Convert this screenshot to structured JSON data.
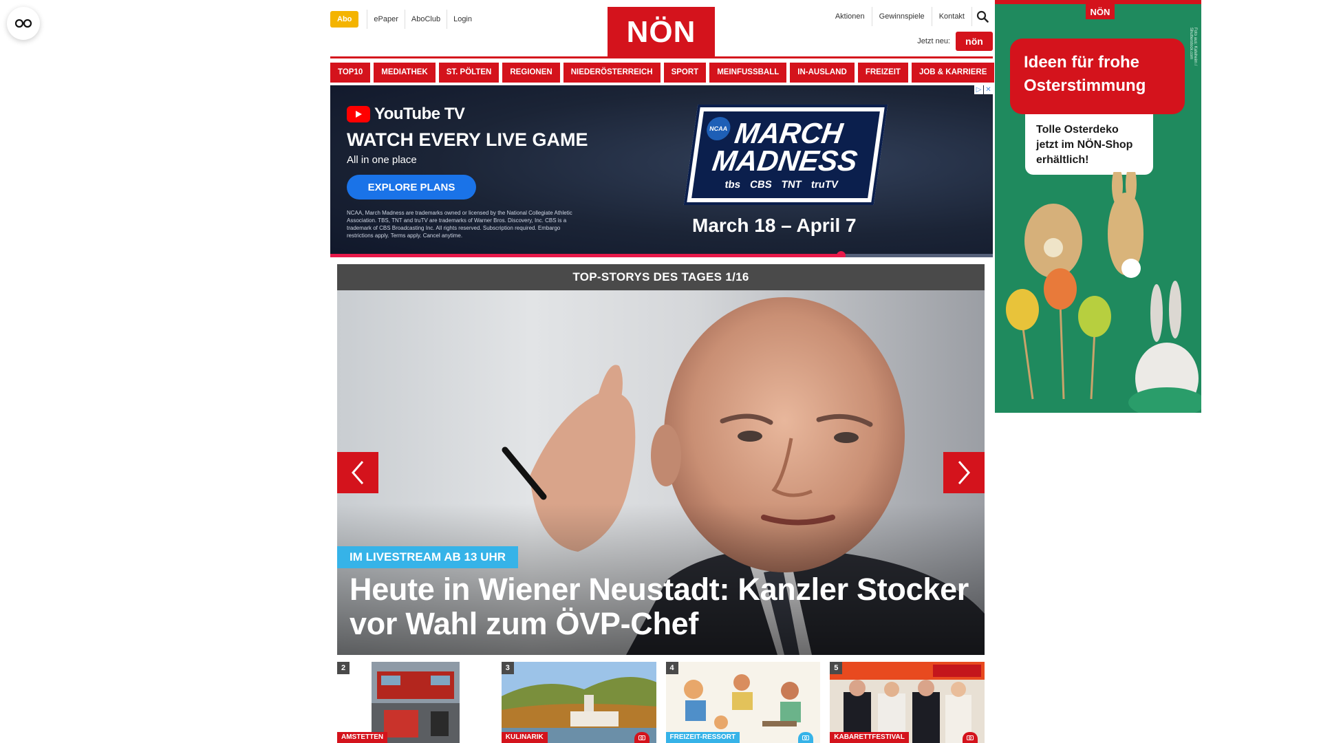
{
  "accessibility": {
    "icon": "eye-glasses-icon"
  },
  "header": {
    "abo": "Abo",
    "links": [
      "ePaper",
      "AboClub",
      "Login"
    ],
    "logo": "NÖN",
    "right_links": [
      "Aktionen",
      "Gewinnspiele",
      "Kontakt"
    ],
    "search_icon": "search-icon",
    "jetzt_neu": "Jetzt neu:",
    "mini_logo": "nön"
  },
  "nav": [
    "TOP10",
    "MEDIATHEK",
    "ST. PÖLTEN",
    "REGIONEN",
    "NIEDERÖSTERREICH",
    "SPORT",
    "MEINFUSSBALL",
    "IN-AUSLAND",
    "FREIZEIT",
    "JOB & KARRIERE"
  ],
  "ad": {
    "brand": "YouTube TV",
    "headline": "WATCH EVERY LIVE GAME",
    "sub": "All in one place",
    "cta": "EXPLORE PLANS",
    "fine_print": "NCAA, March Madness are trademarks owned or licensed by the National Collegiate Athletic Association. TBS, TNT and truTV are trademarks of Warner Bros. Discovery, Inc. CBS is a trademark of CBS Broadcasting Inc. All rights reserved. Subscription required. Embargo restrictions apply. Terms apply. Cancel anytime.",
    "logo_badge": "NCAA",
    "event_title": "MARCH MADNESS",
    "networks": [
      "tbs",
      "CBS",
      "TNT",
      "truTV"
    ],
    "dates": "March 18 – April 7",
    "progress": 0.77,
    "close_glyphs": [
      "▷",
      "✕"
    ]
  },
  "top_stories": {
    "label": "TOP-STORYS DES TAGES 1/16",
    "badge": "IM LIVESTREAM AB 13 UHR",
    "title": "Heute in Wiener Neustadt: Kanzler Stocker vor Wahl zum ÖVP-Chef"
  },
  "teasers": [
    {
      "num": "2",
      "category": "AMSTETTEN",
      "cat_color": "#d4131c",
      "camera": false
    },
    {
      "num": "3",
      "category": "KULINARIK",
      "cat_color": "#d4131c",
      "camera": true
    },
    {
      "num": "4",
      "category": "FREIZEIT-RESSORT",
      "cat_color": "#36b3e8",
      "camera": true
    },
    {
      "num": "5",
      "category": "KABARETTFESTIVAL",
      "cat_color": "#d4131c",
      "camera": true
    }
  ],
  "side_ad": {
    "logo": "NÖN",
    "headline": "Ideen für frohe Osterstimmung",
    "card": "Tolle Osterdeko jetzt im NÖN-Shop erhältlich!",
    "credit": "Foto aus: Kateheim / Shutterstock.com"
  }
}
